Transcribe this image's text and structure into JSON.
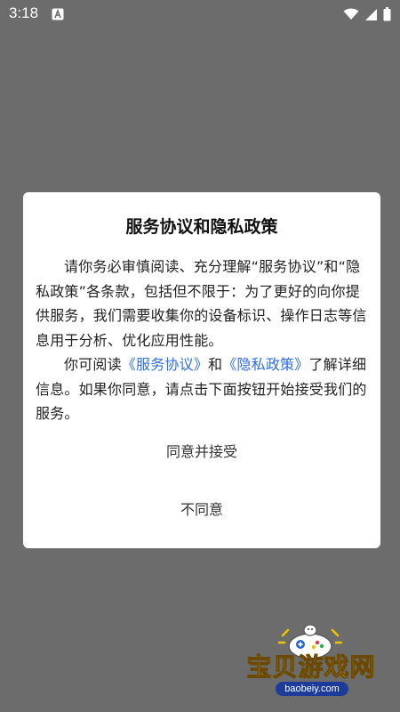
{
  "status_bar": {
    "time": "3:18",
    "icons": [
      "notification-a-icon",
      "wifi-icon",
      "signal-icon",
      "battery-icon"
    ]
  },
  "dialog": {
    "title": "服务协议和隐私政策",
    "paragraph1": "请你务必审慎阅读、充分理解“服务协议”和“隐私政策”各条款，包括但不限于：为了更好的向你提供服务，我们需要收集你的设备标识、操作日志等信息用于分析、优化应用性能。",
    "paragraph2": {
      "part1": "你可阅读",
      "link_service": "《服务协议》",
      "part2": "和",
      "link_privacy": "《隐私政策》",
      "part3": "了解详细信息。如果你同意，请点击下面按钮开始接受我们的服务。"
    },
    "agree_label": "同意并接受",
    "disagree_label": "不同意"
  },
  "watermark": {
    "text": "宝贝游戏网",
    "url": "baobeiy.com"
  },
  "colors": {
    "backdrop": "#6c6c6c",
    "link": "#2f6fe0",
    "dialog_bg": "#ffffff",
    "watermark_text": "#f2c200"
  }
}
